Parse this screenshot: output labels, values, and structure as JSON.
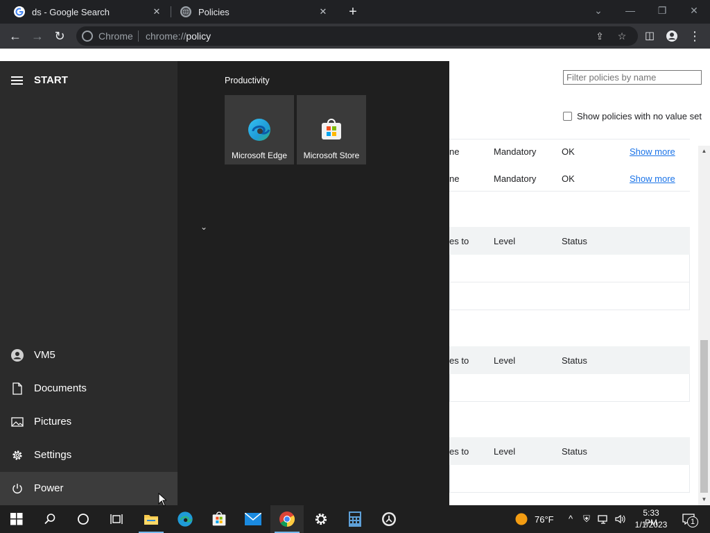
{
  "browser": {
    "tabs": [
      {
        "title": "ds - Google Search",
        "favicon": "google-g-icon"
      },
      {
        "title": "Policies",
        "favicon": "globe-icon"
      }
    ],
    "new_tab": "+",
    "address": {
      "chip": "Chrome",
      "url_prefix": "chrome://",
      "url_path": "policy"
    }
  },
  "policy_page": {
    "filter_placeholder": "Filter policies by name",
    "show_unset_label": "Show policies with no value set",
    "rows": [
      {
        "source_fragment": "ne",
        "level": "Mandatory",
        "status": "OK",
        "action": "Show more"
      },
      {
        "source_fragment": "ne",
        "level": "Mandatory",
        "status": "OK",
        "action": "Show more"
      }
    ],
    "table_headers": [
      {
        "applies_fragment": "es to",
        "level": "Level",
        "status": "Status"
      },
      {
        "applies_fragment": "es to",
        "level": "Level",
        "status": "Status"
      },
      {
        "applies_fragment": "es to",
        "level": "Level",
        "status": "Status"
      }
    ]
  },
  "start_menu": {
    "title": "START",
    "group_title": "Productivity",
    "tiles": [
      {
        "label": "Microsoft Edge",
        "icon": "edge-icon"
      },
      {
        "label": "Microsoft Store",
        "icon": "store-icon"
      }
    ],
    "left_items": [
      {
        "label": "VM5",
        "icon": "user-icon"
      },
      {
        "label": "Documents",
        "icon": "document-icon"
      },
      {
        "label": "Pictures",
        "icon": "pictures-icon"
      },
      {
        "label": "Settings",
        "icon": "gear-icon"
      },
      {
        "label": "Power",
        "icon": "power-icon"
      }
    ]
  },
  "taskbar": {
    "weather": "76°F",
    "time": "5:33 PM",
    "date": "1/1/2023",
    "notification_count": "1",
    "colors": {
      "accent": "#76b9ed",
      "edge": "#1f9bd7",
      "chrome_red": "#db4437"
    }
  }
}
